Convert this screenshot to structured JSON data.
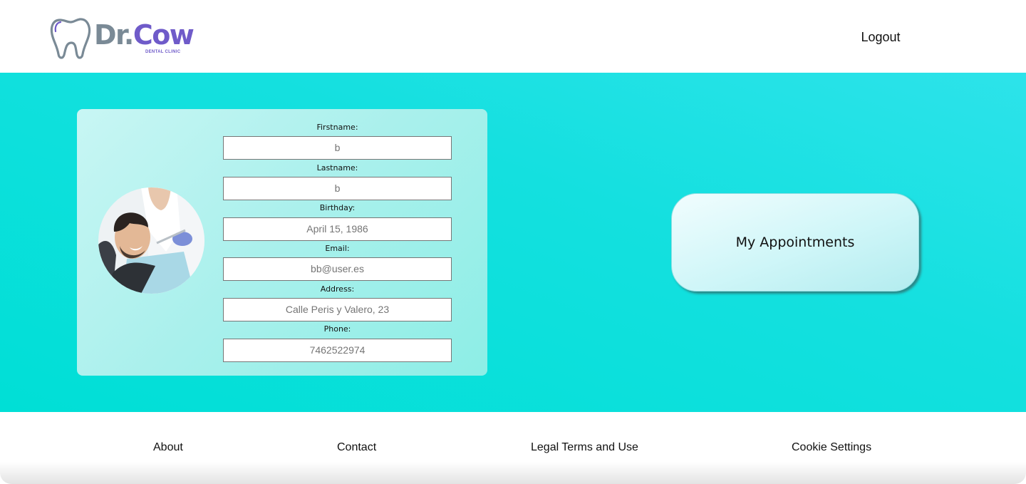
{
  "header": {
    "logo_main_1": "Dr.",
    "logo_main_2": "Cow",
    "logo_sub": "DENTAL CLINIC",
    "logout_label": "Logout"
  },
  "profile": {
    "fields": [
      {
        "label": "Firstname:",
        "value": "b"
      },
      {
        "label": "Lastname:",
        "value": "b"
      },
      {
        "label": "Birthday:",
        "value": "April 15, 1986"
      },
      {
        "label": "Email:",
        "value": "bb@user.es"
      },
      {
        "label": "Address:",
        "value": "Calle Peris y Valero, 23"
      },
      {
        "label": "Phone:",
        "value": "7462522974"
      }
    ]
  },
  "appointments_button": "My Appointments",
  "footer": {
    "links": [
      "About",
      "Contact",
      "Legal Terms and Use",
      "Cookie Settings"
    ]
  },
  "colors": {
    "brand_purple": "#6f5bc9",
    "brand_gray": "#7a8a96",
    "main_bg": "#00dfd6"
  },
  "icons": {
    "logo": "tooth-icon",
    "avatar": "patient-photo"
  }
}
